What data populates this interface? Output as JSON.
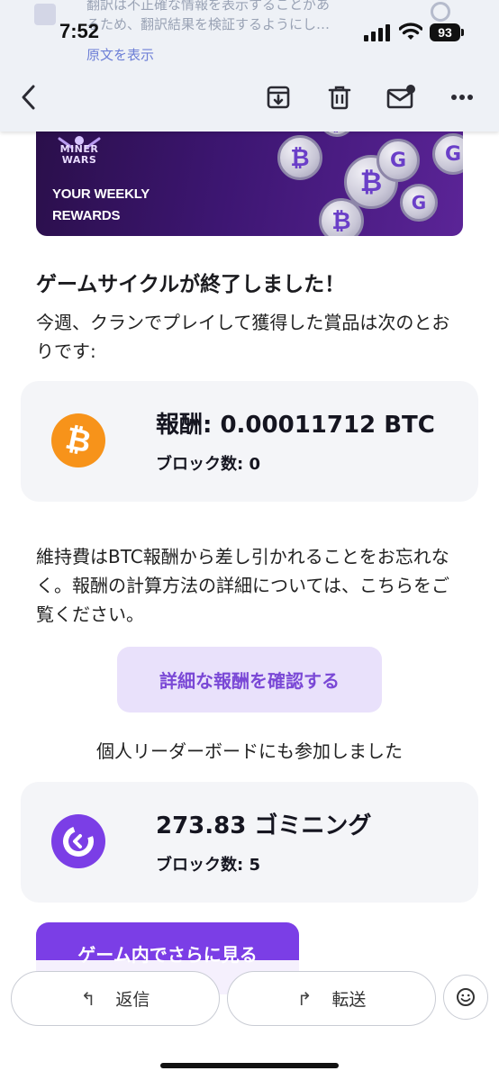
{
  "status": {
    "time": "7:52",
    "battery": "93"
  },
  "translation": {
    "line1": "翻訳は不正確な情報を表示することがあ",
    "line2": "るため、翻訳結果を検証するようにし…",
    "link": "原文を表示"
  },
  "toolbar": {
    "back": "back-icon",
    "archive": "archive-icon",
    "delete": "trash-icon",
    "mark": "mail-unread-icon",
    "more": "more-icon"
  },
  "banner": {
    "logo": "MINER WARS",
    "title_line1": "YOUR WEEKLY",
    "title_line2": "REWARDS"
  },
  "email": {
    "heading": "ゲームサイクルが終了しました！",
    "intro": "今週、クランでプレイして獲得した賞品は次のとおりです:",
    "reward_card": {
      "value": "報酬: 0.00011712 BTC",
      "blocks": "ブロック数: 0"
    },
    "note": "維持費はBTC報酬から差し引かれることをお忘れなく。報酬の計算方法の詳細については、こちらをご覧ください。",
    "cta": "詳細な報酬を確認する",
    "leaderboard_text": "個人リーダーボードにも参加しました",
    "gomining_card": {
      "value": "273.83 ゴミニング",
      "blocks": "ブロック数: 5"
    },
    "game_button": "ゲーム内でさらに見る"
  },
  "bottom": {
    "reply": "返信",
    "forward": "転送"
  },
  "colors": {
    "accent": "#7b3ee6",
    "bitcoin": "#f7931a",
    "cta_bg": "#e9e1fb"
  }
}
